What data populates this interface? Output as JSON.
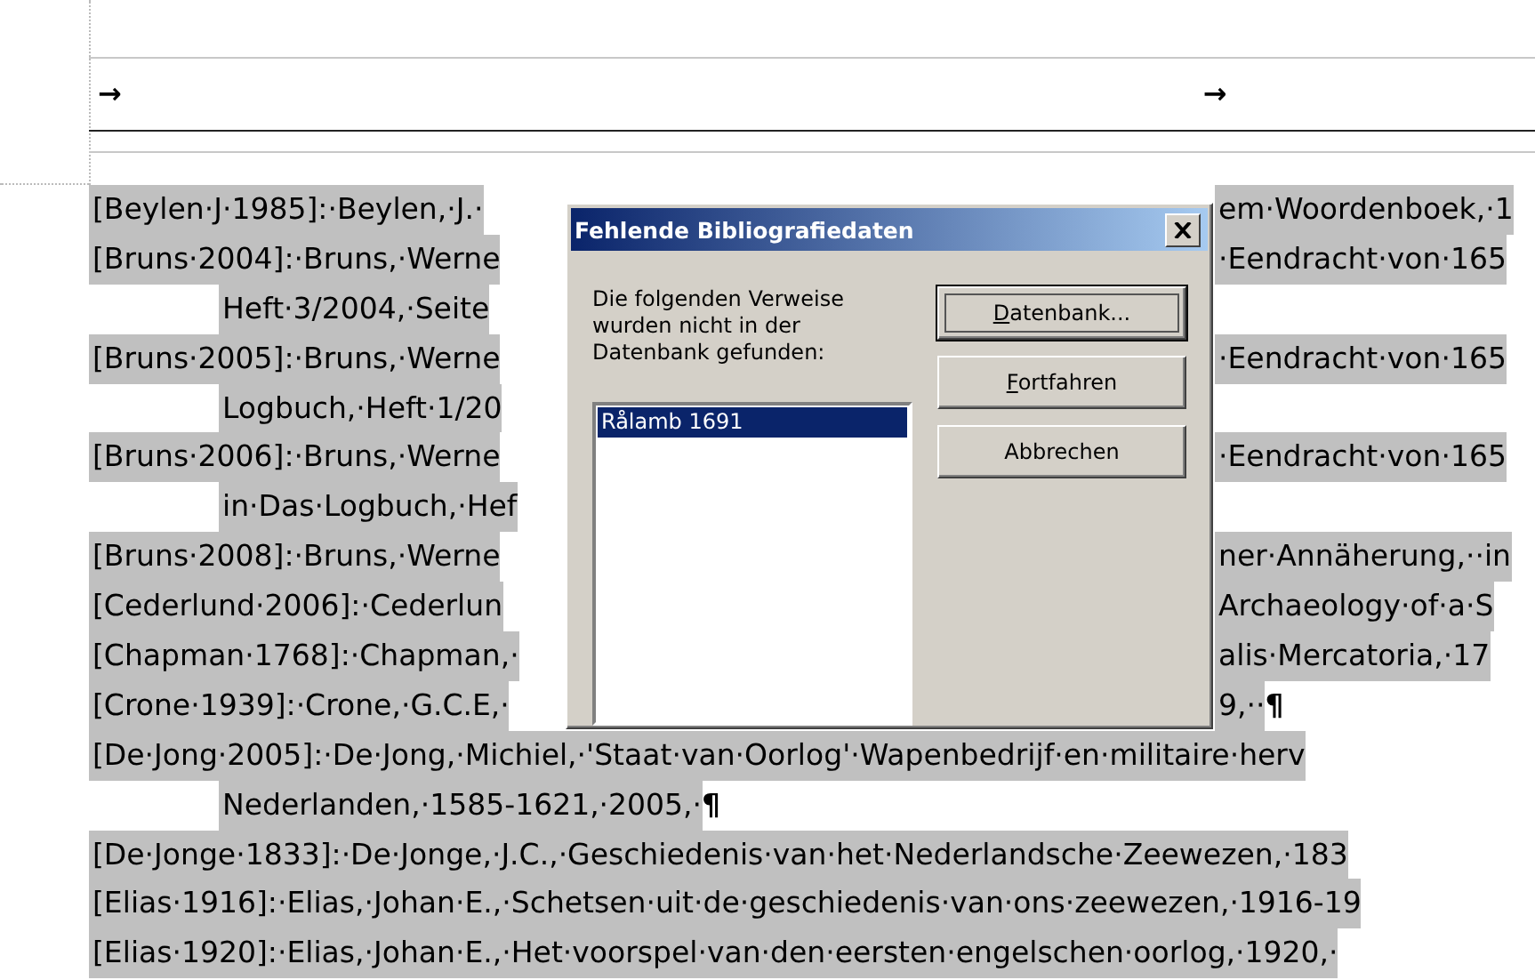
{
  "header": {
    "tab_marks": [
      "→",
      "→"
    ]
  },
  "document": {
    "lines": [
      {
        "kind": "split",
        "left": "[Beylen·J·1985]:·Beylen,·J.·",
        "right": "em·Woordenboek,·1"
      },
      {
        "kind": "split",
        "left": "[Bruns·2004]:·Bruns,·Werne",
        "right": "·Eendracht·von·165"
      },
      {
        "kind": "indent",
        "left": "Heft·3/2004,·Seite"
      },
      {
        "kind": "split",
        "left": "[Bruns·2005]:·Bruns,·Werne",
        "right": "·Eendracht·von·165"
      },
      {
        "kind": "indent",
        "left": "Logbuch,·Heft·1/20"
      },
      {
        "kind": "split",
        "left": "[Bruns·2006]:·Bruns,·Werne",
        "right": "·Eendracht·von·165"
      },
      {
        "kind": "indent",
        "left": "in·Das·Logbuch,·Hef"
      },
      {
        "kind": "split",
        "left": "[Bruns·2008]:·Bruns,·Werne",
        "right": "ner·Annäherung,··in"
      },
      {
        "kind": "split",
        "left": "[Cederlund·2006]:·Cederlun",
        "right": "Archaeology·of·a·S"
      },
      {
        "kind": "split",
        "left": "[Chapman·1768]:·Chapman,·",
        "right": "alis·Mercatoria,·17"
      },
      {
        "kind": "split",
        "left": "[Crone·1939]:·Crone,·G.C.E,·",
        "right": "9,··",
        "end": "¶"
      },
      {
        "kind": "full",
        "left": "[De·Jong·2005]:·De·Jong,·Michiel,·'Staat·van·Oorlog'·Wapenbedrijf·en·militaire·herv"
      },
      {
        "kind": "indent",
        "left": "Nederlanden,·1585-1621,·2005,·",
        "end": "¶"
      },
      {
        "kind": "full",
        "left": "[De·Jonge·1833]:·De·Jonge,·J.C.,·Geschiedenis·van·het·Nederlandsche·Zeewezen,·183"
      },
      {
        "kind": "full",
        "left": "[Elias·1916]:·Elias,·Johan·E.,·Schetsen·uit·de·geschiedenis·van·ons·zeewezen,·1916-19"
      },
      {
        "kind": "full",
        "left": "[Elias·1920]:·Elias,·Johan·E.,·Het·voorspel·van·den·eersten·engelschen·oorlog,·1920,·"
      }
    ]
  },
  "dialog": {
    "title": "Fehlende Bibliografiedaten",
    "message": "Die folgenden Verweise wurden nicht in der Datenbank gefunden:",
    "list": [
      {
        "label": "Rålamb 1691",
        "selected": true
      }
    ],
    "buttons": [
      {
        "label": "Datenbank...",
        "default": true,
        "mnemonic_underlined": true
      },
      {
        "label": "Fortfahren",
        "default": false,
        "mnemonic_underlined": true
      },
      {
        "label": "Abbrechen",
        "default": false,
        "mnemonic_underlined": false
      }
    ]
  }
}
